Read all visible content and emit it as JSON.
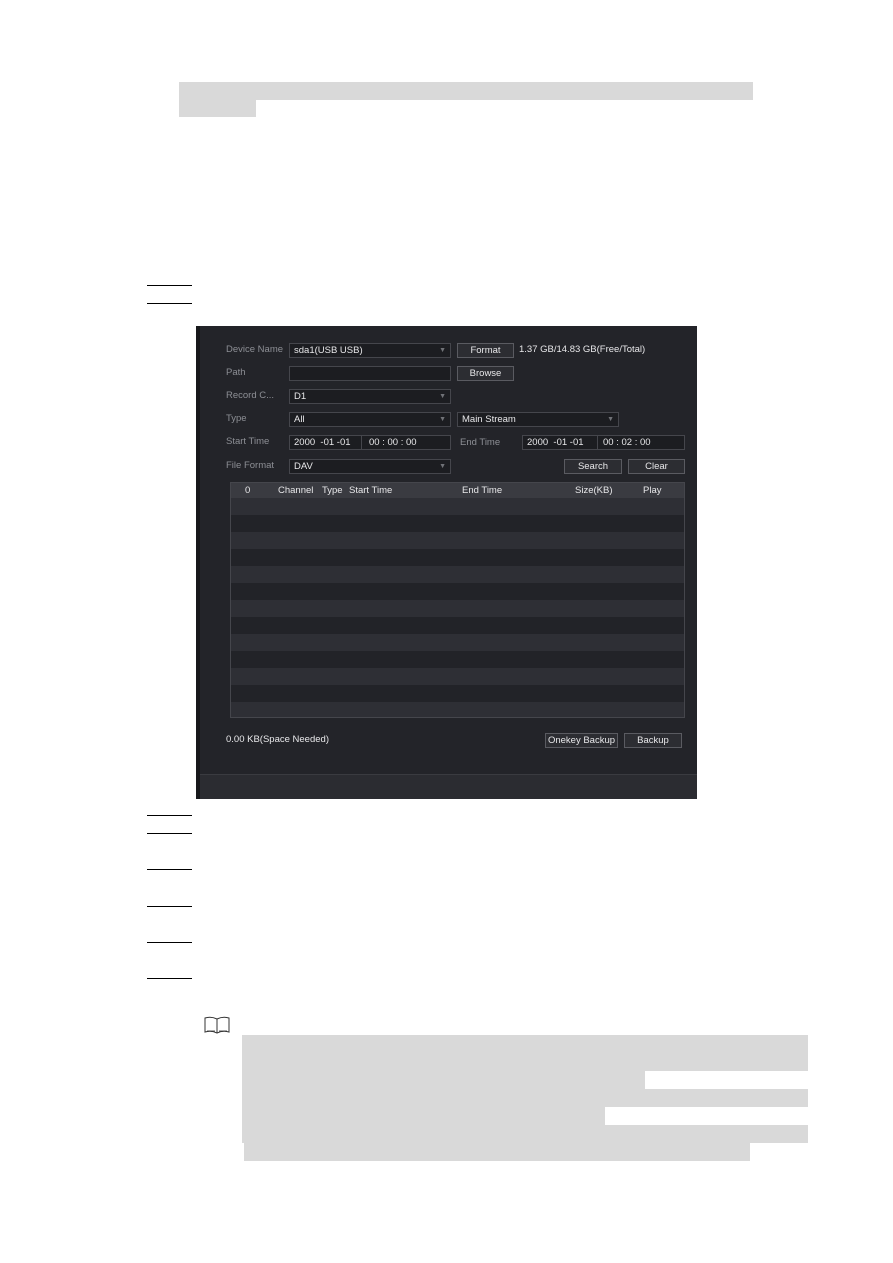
{
  "document": {
    "redacted_blocks_note": "",
    "step_markers_count": 8
  },
  "panel": {
    "device_name": {
      "label": "Device Name",
      "value": "sda1(USB USB)"
    },
    "format_button": "Format",
    "storage_info": "1.37 GB/14.83 GB(Free/Total)",
    "path": {
      "label": "Path",
      "value": ""
    },
    "browse_button": "Browse",
    "record_channel": {
      "label": "Record C...",
      "value": "D1"
    },
    "type": {
      "label": "Type",
      "value": "All",
      "stream": "Main Stream"
    },
    "start_time": {
      "label": "Start Time",
      "date": "2000  -01 -01",
      "time": "00 : 00 : 00"
    },
    "end_time": {
      "label": "End Time",
      "date": "2000  -01 -01",
      "time": "00 : 02 : 00"
    },
    "file_format": {
      "label": "File Format",
      "value": "DAV"
    },
    "search_button": "Search",
    "clear_button": "Clear",
    "table": {
      "columns": [
        "0",
        "Channel",
        "Type",
        "Start Time",
        "End Time",
        "Size(KB)",
        "Play"
      ],
      "rows": []
    },
    "space_needed": "0.00 KB(Space Needed)",
    "onekey_backup_button": "Onekey Backup",
    "backup_button": "Backup"
  }
}
